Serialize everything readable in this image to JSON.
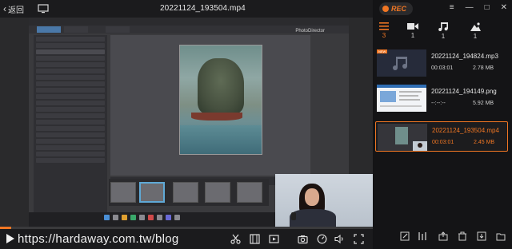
{
  "topbar": {
    "back_label": "返回",
    "file_title": "20221124_193504.mp4"
  },
  "video": {
    "app_brand": "PhotoDirector",
    "progress_fraction": 0.03
  },
  "controls": {
    "watermark": "https://hardaway.com.tw/blog"
  },
  "sidebar": {
    "rec_label": "REC",
    "filters": [
      {
        "icon": "list-icon",
        "count": "3"
      },
      {
        "icon": "video-camera-icon",
        "count": "1"
      },
      {
        "icon": "music-note-icon",
        "count": "1"
      },
      {
        "icon": "image-icon",
        "count": "1"
      }
    ],
    "items": [
      {
        "name": "20221124_194824.mp3",
        "duration": "00:03:01",
        "size": "2.78 MB",
        "badge": "NEW"
      },
      {
        "name": "20221124_194149.png",
        "duration": "--:--:--",
        "size": "5.92 MB"
      },
      {
        "name": "20221124_193504.mp4",
        "duration": "00:03:01",
        "size": "2.45 MB"
      }
    ]
  },
  "colors": {
    "accent": "#f07623",
    "background": "#1a1a1c"
  }
}
